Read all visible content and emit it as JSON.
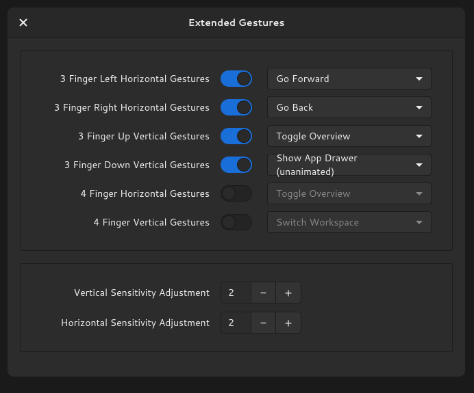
{
  "window": {
    "title": "Extended Gestures"
  },
  "gestures": [
    {
      "label": "3 Finger Left Horizontal Gestures",
      "enabled": true,
      "action": "Go Forward"
    },
    {
      "label": "3 Finger Right Horizontal Gestures",
      "enabled": true,
      "action": "Go Back"
    },
    {
      "label": "3 Finger Up Vertical Gestures",
      "enabled": true,
      "action": "Toggle Overview"
    },
    {
      "label": "3 Finger Down Vertical Gestures",
      "enabled": true,
      "action": "Show App Drawer (unanimated)"
    },
    {
      "label": "4 Finger Horizontal Gestures",
      "enabled": false,
      "action": "Toggle Overview"
    },
    {
      "label": "4 Finger Vertical Gestures",
      "enabled": false,
      "action": "Switch Workspace"
    }
  ],
  "sensitivity": {
    "vertical": {
      "label": "Vertical Sensitivity Adjustment",
      "value": "2"
    },
    "horizontal": {
      "label": "Horizontal Sensitivity Adjustment",
      "value": "2"
    }
  },
  "glyphs": {
    "minus": "−",
    "plus": "+"
  }
}
